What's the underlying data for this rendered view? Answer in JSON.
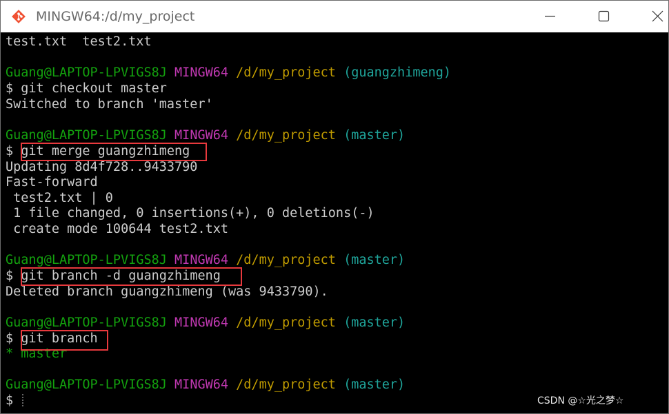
{
  "window": {
    "title": "MINGW64:/d/my_project"
  },
  "icons": {
    "app": "git-diamond-icon",
    "minimize": "minimize-icon",
    "maximize": "maximize-icon",
    "close": "close-icon"
  },
  "colors": {
    "user": "#13a10e",
    "system": "#c239b3",
    "path": "#c19c00",
    "branch": "#1fa59b",
    "text": "#cccccc",
    "highlight": "#e8393d"
  },
  "terminal": {
    "line_ls": "test.txt  test2.txt",
    "prompt_user": "Guang@LAPTOP-LPVIGS8J",
    "prompt_sys": "MINGW64",
    "prompt_path": "/d/my_project",
    "branch_feature": "(guangzhimeng)",
    "branch_master": "(master)",
    "dollar": "$",
    "cmd_checkout": "git checkout master",
    "out_switched": "Switched to branch 'master'",
    "cmd_merge": "git merge guangzhimeng",
    "out_updating": "Updating 8d4f728..9433790",
    "out_fastforward": "Fast-forward",
    "out_stat": " test2.txt | 0",
    "out_changed": " 1 file changed, 0 insertions(+), 0 deletions(-)",
    "out_create": " create mode 100644 test2.txt",
    "cmd_branch_delete": "git branch -d guangzhimeng",
    "out_deleted": "Deleted branch guangzhimeng (was 9433790).",
    "cmd_branch": "git branch",
    "out_branch_list": "* master"
  },
  "watermark": "CSDN @☆光之梦☆"
}
